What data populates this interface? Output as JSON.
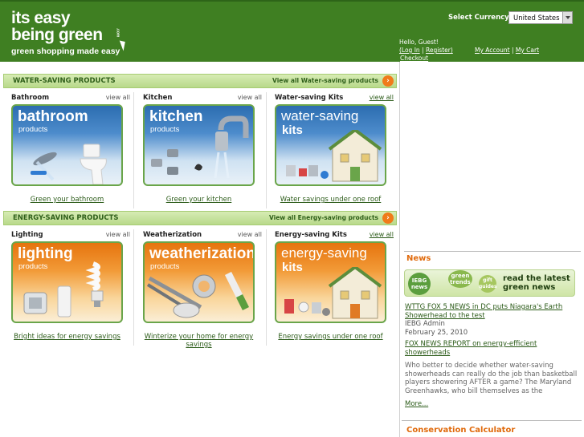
{
  "header": {
    "logo_line1": "its easy",
    "logo_line2": "being green",
    "logo_tm": ".com",
    "tagline": "green shopping made easy",
    "currency_label": "Select Currency:",
    "currency_value": "United States",
    "greeting": "Hello, Guest!",
    "login": "(Log In",
    "register": "Register)",
    "my_account": "My Account",
    "my_cart": "My Cart",
    "checkout": "Checkout"
  },
  "sections": [
    {
      "title": "WATER-SAVING PRODUCTS",
      "view_all": "View all Water-saving products",
      "categories": [
        {
          "name": "Bathroom",
          "view_all": "view all",
          "card_title": "bathroom",
          "card_sub": "products",
          "caption": "Green your bathroom"
        },
        {
          "name": "Kitchen",
          "view_all": "view all",
          "card_title": "kitchen",
          "card_sub": "products",
          "caption": "Green your kitchen"
        },
        {
          "name": "Water-saving Kits",
          "view_all": "view all",
          "card_title": "water-saving",
          "card_sub": "kits",
          "caption": "Water savings under one roof"
        }
      ]
    },
    {
      "title": "ENERGY-SAVING PRODUCTS",
      "view_all": "View all Energy-saving products",
      "categories": [
        {
          "name": "Lighting",
          "view_all": "view all",
          "card_title": "lighting",
          "card_sub": "products",
          "caption": "Bright ideas for energy savings"
        },
        {
          "name": "Weatherization",
          "view_all": "view all",
          "card_title": "weatherization",
          "card_sub": "products",
          "caption": "Winterize your home for energy savings"
        },
        {
          "name": "Energy-saving Kits",
          "view_all": "view all",
          "card_title": "energy-saving",
          "card_sub": "kits",
          "caption": "Energy savings under one roof"
        }
      ]
    }
  ],
  "sidebar": {
    "news_title": "News",
    "banner_bubbles": [
      "IEBG news",
      "green trends",
      "gift guides"
    ],
    "banner_text": "read the latest green news",
    "news": [
      {
        "title": "WTTG FOX 5 NEWS in DC puts Niagara's Earth Showerhead to the test",
        "author": "IEBG Admin",
        "date": "February 25, 2010"
      },
      {
        "title": "FOX NEWS REPORT on energy-efficient showerheads",
        "body": "Who better to decide whether water-saving showerheads can really do the job than basketball players showering AFTER a game? The Maryland Greenhawks, who bill themselves as the",
        "more": "More..."
      }
    ],
    "conservation_title": "Conservation Calculator"
  }
}
